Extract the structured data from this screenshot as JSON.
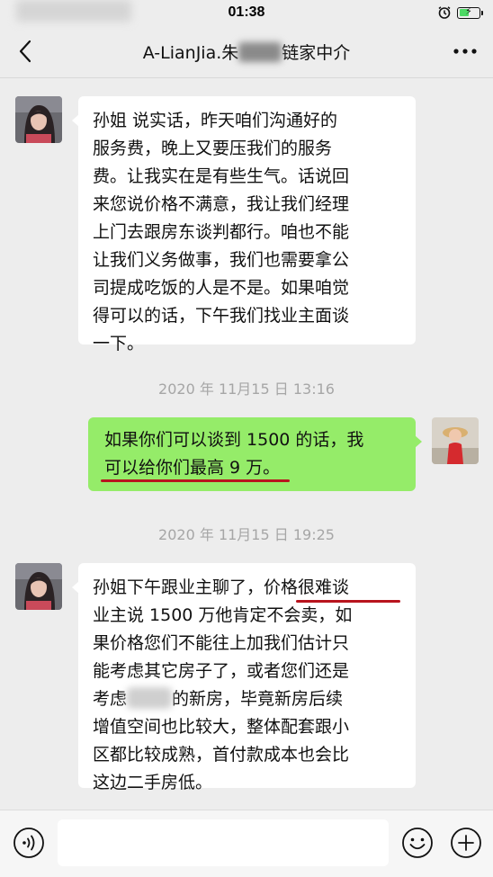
{
  "status_bar": {
    "time": "01:38",
    "battery_level": 0.5
  },
  "nav": {
    "title_prefix": "A-LianJia.朱",
    "title_suffix": "链家中介"
  },
  "messages": [
    {
      "side": "left",
      "lines": [
        "孙姐 说实话，昨天咱们沟通好的",
        "服务费，晚上又要压我们的服务",
        "费。让我实在是有些生气。话说回",
        "来您说价格不满意，我让我们经理",
        "上门去跟房东谈判都行。咱也不能",
        "让我们义务做事，我们也需要拿公",
        "司提成吃饭的人是不是。如果咱觉",
        "得可以的话，下午我们找业主面谈",
        "一下。"
      ]
    },
    {
      "timestamp": "2020 年 11月15 日 13:16"
    },
    {
      "side": "right",
      "lines": [
        "如果你们可以谈到 1500 的话，我",
        "可以给你们最高 9 万。"
      ]
    },
    {
      "timestamp": "2020 年 11月15 日  19:25"
    },
    {
      "side": "left",
      "lines": [
        "孙姐下午跟业主聊了，价格很难谈",
        "业主说 1500 万他肯定不会卖，如",
        "果价格您们不能往上加我们估计只",
        "能考虑其它房子了，或者您们还是",
        "考虑",
        "的新房，毕竟新房后续",
        "增值空间也比较大，整体配套跟小",
        "区都比较成熟，首付款成本也会比",
        "这边二手房低。"
      ]
    }
  ],
  "colors": {
    "background": "#ededed",
    "bubble_self": "#95ec69",
    "bubble_other": "#ffffff",
    "highlight_underline": "#b8141e",
    "timestamp_text": "#a6a6a6"
  },
  "icons": {
    "back": "chevron-left-icon",
    "more": "more-dots-icon",
    "voice": "voice-icon",
    "emoji": "emoji-icon",
    "add": "plus-circle-icon",
    "alarm": "alarm-icon",
    "battery": "battery-icon"
  }
}
